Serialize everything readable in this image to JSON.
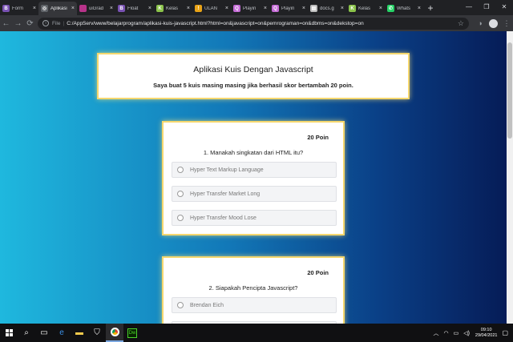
{
  "browser": {
    "tabs": [
      {
        "label": "Form",
        "favicon": "bootstrap-icon",
        "color": "#7952b3",
        "glyph": "B",
        "active": false
      },
      {
        "label": "Aplikasi",
        "favicon": "globe-icon",
        "color": "#5f6368",
        "glyph": "◎",
        "active": true
      },
      {
        "label": "uiGrad",
        "favicon": "uigradients-icon",
        "color": "#b8338a",
        "glyph": "",
        "active": false
      },
      {
        "label": "Float",
        "favicon": "bootstrap-icon",
        "color": "#7952b3",
        "glyph": "B",
        "active": false
      },
      {
        "label": "Kelas",
        "favicon": "sekolahkoding-icon",
        "color": "#8bc34a",
        "glyph": "K",
        "active": false
      },
      {
        "label": "ULAN",
        "favicon": "warning-icon",
        "color": "#e8a317",
        "glyph": "!",
        "active": false
      },
      {
        "label": "Playin",
        "favicon": "playing-icon",
        "color": "#c46bd6",
        "glyph": "Q",
        "active": false
      },
      {
        "label": "Playin",
        "favicon": "playing-icon",
        "color": "#c46bd6",
        "glyph": "Q",
        "active": false
      },
      {
        "label": "docs.g",
        "favicon": "document-icon",
        "color": "#bdbdbd",
        "glyph": "▤",
        "active": false
      },
      {
        "label": "Kelas",
        "favicon": "sekolahkoding-icon",
        "color": "#8bc34a",
        "glyph": "K",
        "active": false
      },
      {
        "label": "Whats",
        "favicon": "whatsapp-icon",
        "color": "#25d366",
        "glyph": "✆",
        "active": false
      }
    ],
    "close_glyph": "×",
    "new_tab_glyph": "+",
    "scheme": "File",
    "url": "C:/AppServ/www/belajarprogram/aplikasi-kuis-javascript.html?html=on&javascript=on&pemrograman=on&dbms=on&dekstop=on"
  },
  "header": {
    "title": "Aplikasi Kuis Dengan Javascript",
    "subtitle": "Saya buat 5 kuis masing masing jika berhasil skor bertambah 20 poin."
  },
  "quizzes": [
    {
      "points": "20 Poin",
      "question": "1. Manakah singkatan dari HTML itu?",
      "options": [
        "Hyper Text Markup Language",
        "Hyper Transfer Market Long",
        "Hyper Transfer Mood Lose"
      ]
    },
    {
      "points": "20 Poin",
      "question": "2. Siapakah Pencipta Javascript?",
      "options": [
        "Brendan Eich",
        ""
      ]
    }
  ],
  "taskbar": {
    "time": "09:10",
    "date": "29/04/2021"
  },
  "colors": {
    "gradient_start": "#1fb8de",
    "gradient_end": "#061c57",
    "card_border": "#f5d76e"
  }
}
